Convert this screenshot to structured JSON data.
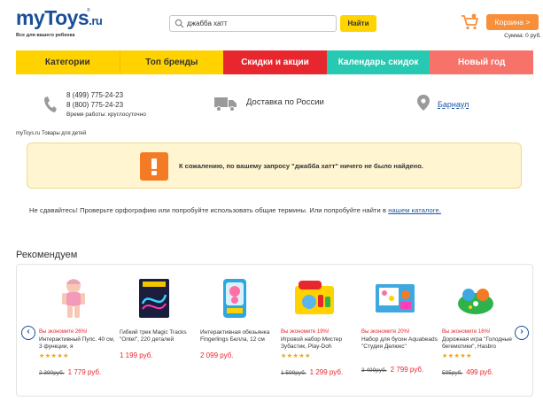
{
  "header": {
    "logo_text": "myToys",
    "logo_domain": ".ru",
    "logo_tm": "®",
    "logo_tagline": "Все для вашего ребенка",
    "search_value": "джабба хатт",
    "search_button": "Найти",
    "cart_label": "Корзина >",
    "cart_sum": "Сумма: 0 руб."
  },
  "nav": [
    {
      "label": "Категории"
    },
    {
      "label": "Топ бренды"
    },
    {
      "label": "Скидки и акции"
    },
    {
      "label": "Календарь скидок"
    },
    {
      "label": "Новый год"
    }
  ],
  "contacts": {
    "phone1": "8 (499) 775-24-23",
    "phone2": "8 (800) 775-24-23",
    "hours": "Время работы: круглосуточно",
    "delivery": "Доставка по России",
    "city": "Барнаул"
  },
  "breadcrumb": "myToys.ru Товары для детей",
  "alert": {
    "message": "К сожалению, по вашему запросу \"джабба хатт\" ничего не было найдено."
  },
  "hint": {
    "text": "Не сдавайтесь! Проверьте орфографию или попробуйте использовать общие термины. Или попробуйте найти в ",
    "link": "нашем каталоге."
  },
  "recommend": {
    "title": "Рекомендуем",
    "products": [
      {
        "promo": "Вы экономите 26%!",
        "name": "Интерактивный Пупс. 40 см, 3 функции, я",
        "stars": "★★★★★",
        "old_price": "2 390руб.",
        "price": "1 779 руб."
      },
      {
        "promo": "",
        "name": "Гибкий трек Magic Tracks \"Ontel\", 220 деталей",
        "stars": "",
        "old_price": "",
        "price": "1 199 руб."
      },
      {
        "promo": "",
        "name": "Интерактивная обезьянка Fingerlings Белла, 12 см",
        "stars": "",
        "old_price": "",
        "price": "2 099 руб."
      },
      {
        "promo": "Вы экономите 19%!",
        "name": "Игровой набор Мистер Зубастик, Play-Doh",
        "stars": "★★★★★",
        "old_price": "1 599руб.",
        "price": "1 299 руб."
      },
      {
        "promo": "Вы экономите 20%!",
        "name": "Набор для бусин Aquabeads \"Студия Делюкс\"",
        "stars": "",
        "old_price": "3 499руб.",
        "price": "2 799 руб."
      },
      {
        "promo": "Вы экономите 16%!",
        "name": "Дорожная игра \"Голодные бегемотики\", Hasbro",
        "stars": "★★★★★",
        "old_price": "595руб.",
        "price": "499 руб."
      }
    ]
  },
  "icons": {
    "search": "search-icon",
    "cart": "cart-icon",
    "phone": "phone-icon",
    "truck": "truck-icon",
    "pin": "location-pin-icon",
    "warning": "warning-icon",
    "arrow_left": "arrow-left-icon",
    "arrow_right": "arrow-right-icon"
  },
  "colors": {
    "brand_blue": "#1a4f98",
    "yellow": "#ffd200",
    "red": "#e8262d",
    "teal": "#27c9b2",
    "coral": "#f7736a",
    "orange": "#f88f3a"
  }
}
